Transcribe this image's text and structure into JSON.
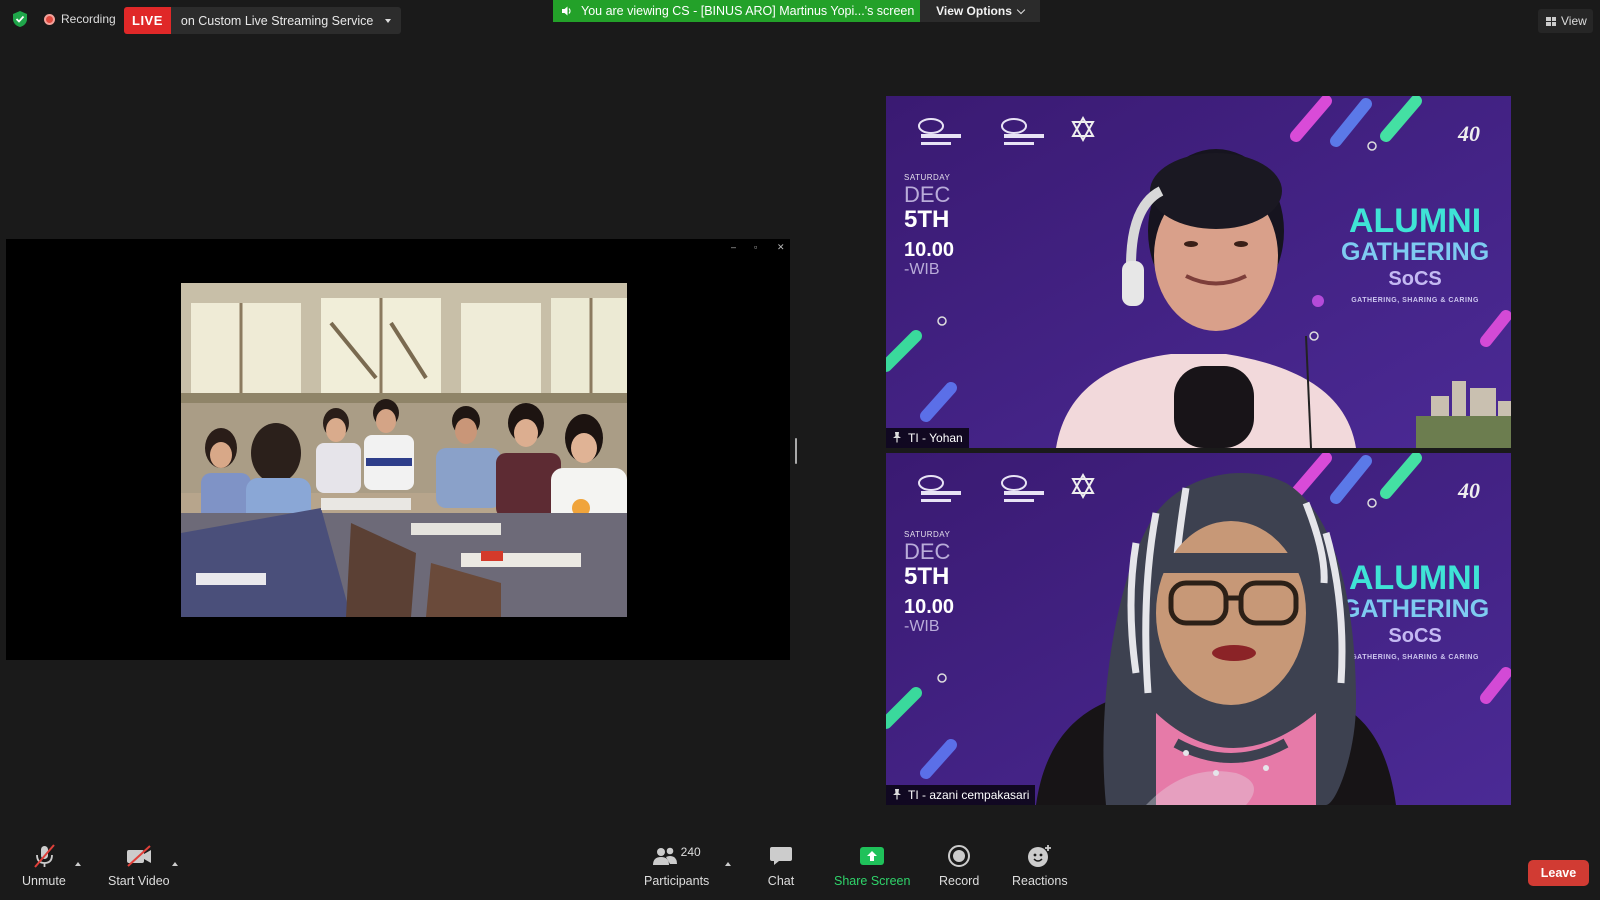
{
  "top_bar": {
    "recording_label": "Recording",
    "live_tag": "LIVE",
    "live_service": "on Custom Live Streaming Service",
    "viewing_banner": "You are viewing CS - [BINUS ARO] Martinus Yopi...'s screen",
    "view_options": "View Options",
    "view_label": "View"
  },
  "participants": [
    {
      "name": "TI - Yohan"
    },
    {
      "name": "TI - azani cempakasari"
    }
  ],
  "poster": {
    "day": "SATURDAY",
    "month": "DEC",
    "date": "5TH",
    "time": "10.00",
    "tz": "-WIB",
    "title1": "ALUMNI",
    "title2": "GATHERING",
    "title3": "SoCS",
    "tagline": "GATHERING, SHARING & CARING"
  },
  "toolbar": {
    "unmute": "Unmute",
    "start_video": "Start Video",
    "participants_count": "240",
    "participants": "Participants",
    "chat": "Chat",
    "share_screen": "Share Screen",
    "record": "Record",
    "reactions": "Reactions",
    "leave": "Leave"
  },
  "colors": {
    "live": "#e02828",
    "banner": "#23a129",
    "share_green": "#1fc15a",
    "leave": "#d13b33",
    "poster_bg": "#3d1d78"
  }
}
